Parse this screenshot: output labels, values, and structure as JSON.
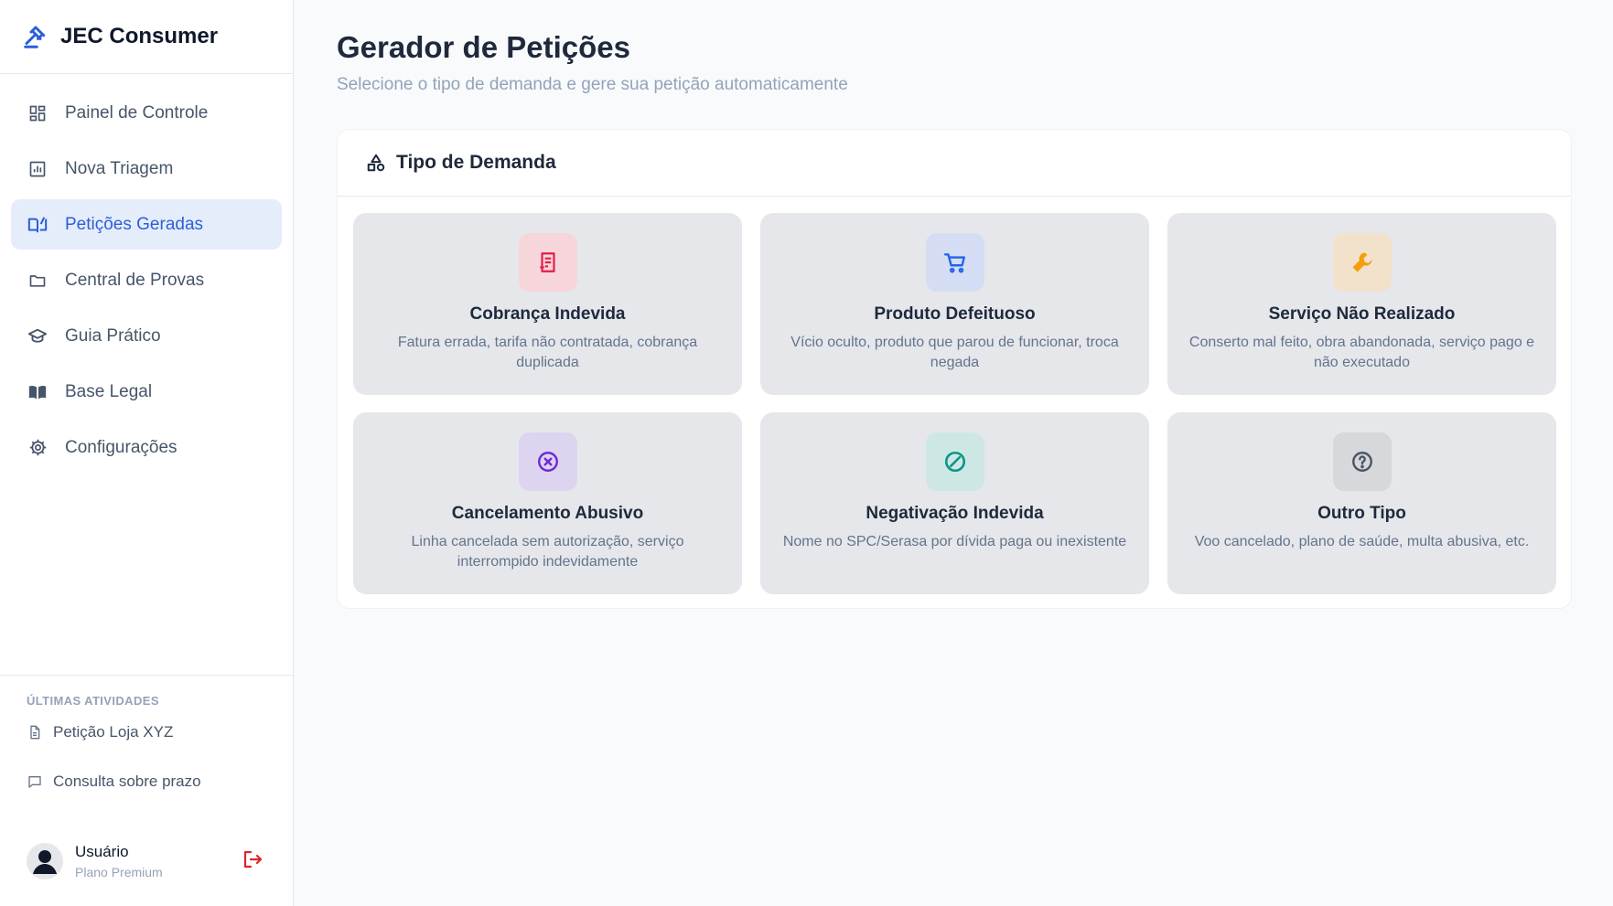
{
  "app": {
    "name": "JEC Consumer"
  },
  "sidebar": {
    "items": [
      {
        "label": "Painel de Controle",
        "icon": "dashboard-icon",
        "active": false
      },
      {
        "label": "Nova Triagem",
        "icon": "chart-icon",
        "active": false
      },
      {
        "label": "Petições Geradas",
        "icon": "book-edit-icon",
        "active": true
      },
      {
        "label": "Central de Provas",
        "icon": "folder-icon",
        "active": false
      },
      {
        "label": "Guia Prático",
        "icon": "graduation-cap-icon",
        "active": false
      },
      {
        "label": "Base Legal",
        "icon": "open-book-icon",
        "active": false
      },
      {
        "label": "Configurações",
        "icon": "gear-icon",
        "active": false
      }
    ],
    "recent_title": "ÚLTIMAS ATIVIDADES",
    "recent": [
      {
        "label": "Petição Loja XYZ",
        "icon": "document-icon"
      },
      {
        "label": "Consulta sobre prazo",
        "icon": "chat-icon"
      }
    ],
    "user": {
      "name": "Usuário",
      "plan": "Plano Premium"
    }
  },
  "main": {
    "title": "Gerador de Petições",
    "subtitle": "Selecione o tipo de demanda e gere sua petição automaticamente",
    "panel": {
      "title": "Tipo de Demanda",
      "cards": [
        {
          "title": "Cobrança Indevida",
          "desc": "Fatura errada, tarifa não contratada, cobrança duplicada",
          "icon": "receipt-icon",
          "color": "#e11d48",
          "bg": "#f6d6da"
        },
        {
          "title": "Produto Defeituoso",
          "desc": "Vício oculto, produto que parou de funcionar, troca negada",
          "icon": "cart-icon",
          "color": "#2563eb",
          "bg": "#d4ddf3"
        },
        {
          "title": "Serviço Não Realizado",
          "desc": "Conserto mal feito, obra abandonada, serviço pago e não executado",
          "icon": "wrench-icon",
          "color": "#f59e0b",
          "bg": "#f2e2cb"
        },
        {
          "title": "Cancelamento Abusivo",
          "desc": "Linha cancelada sem autorização, serviço interrompido indevidamente",
          "icon": "x-circle-icon",
          "color": "#6d28d9",
          "bg": "#ddd4f0"
        },
        {
          "title": "Negativação Indevida",
          "desc": "Nome no SPC/Serasa por dívida paga ou inexistente",
          "icon": "ban-icon",
          "color": "#0d9488",
          "bg": "#cde8e4"
        },
        {
          "title": "Outro Tipo",
          "desc": "Voo cancelado, plano de saúde, multa abusiva, etc.",
          "icon": "question-circle-icon",
          "color": "#4b5563",
          "bg": "#d6d8dc"
        }
      ]
    }
  }
}
